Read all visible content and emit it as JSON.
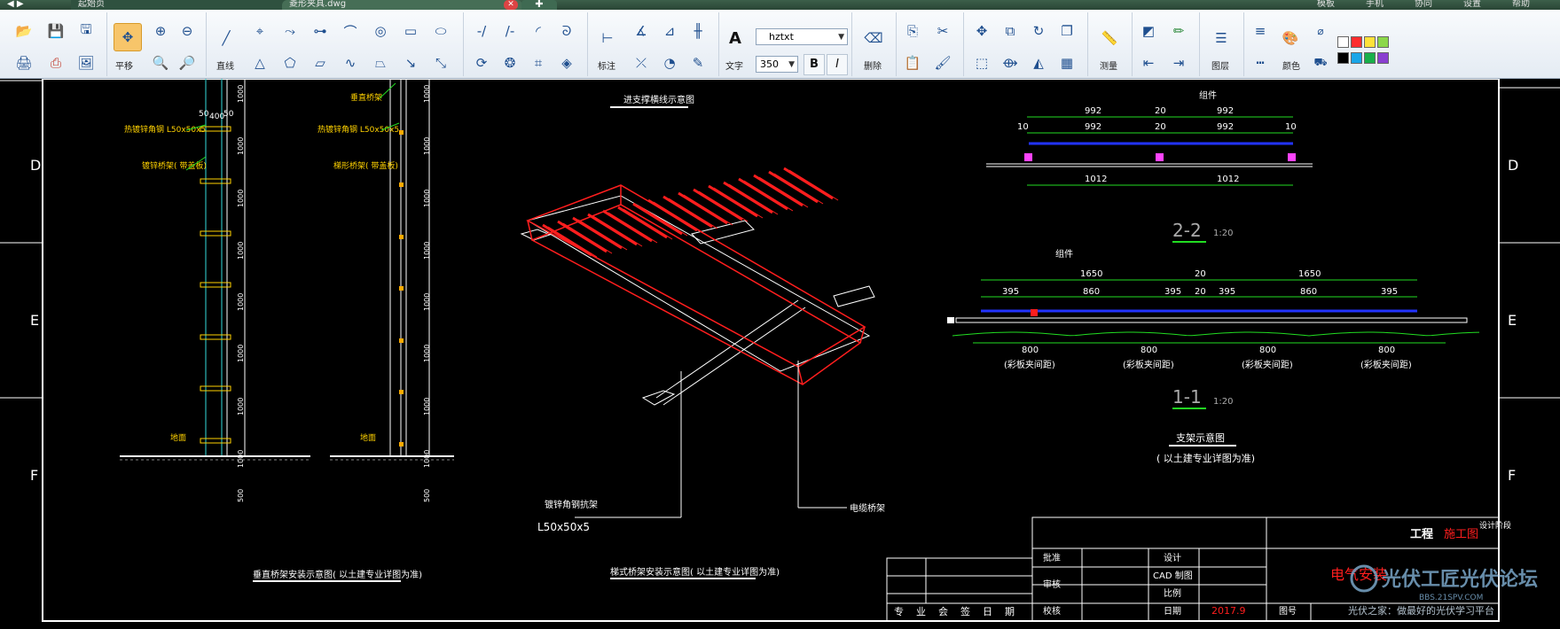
{
  "tabs": {
    "home": "起始页",
    "active": "菱形夹具.dwg",
    "close_glyph": "✕",
    "new_glyph": "✚"
  },
  "top_menu": [
    "模板",
    "手机",
    "协同",
    "设置",
    "帮助"
  ],
  "toolbar": {
    "pan_label": "平移",
    "line_label": "直线",
    "annotate_label": "标注",
    "text_label": "文字",
    "font_name": "hztxt",
    "font_size": "350",
    "bold": "B",
    "italic": "I",
    "delete_label": "删除",
    "measure_label": "测量",
    "layer_label": "图层",
    "color_label": "颜色"
  },
  "colors": {
    "swatches_row1": [
      "#ffffff",
      "#ff2d2d",
      "#ffe23a",
      "#8bd74a"
    ],
    "swatches_row2": [
      "#000000",
      "#1aa6e8",
      "#19b04a",
      "#8a3fd0"
    ],
    "cad_red": "#ff1e1e",
    "cad_green": "#22dd22",
    "cad_cyan": "#33dddd",
    "cad_white": "#ffffff",
    "cad_yellow": "#ffd200",
    "cad_magenta": "#ff44ff"
  },
  "drawing": {
    "row_labels": [
      "D",
      "E",
      "F"
    ],
    "vertical_title": "垂直桥架安装示意图( 以土建专业详图为准)",
    "ladder_label": "进支撑横线示意图",
    "tray_title": "梯式桥架安装示意图( 以土建专业详图为准)",
    "bracket_label": "镀锌角钢抗架",
    "bracket_size": "L50x50x5",
    "tray_label": "电缆桥架",
    "left_annotations": [
      "热镀锌角钢 L50x50x5",
      "镀锌桥架( 带盖板)",
      "地面"
    ],
    "right_annotations": [
      "垂直桥架",
      "热镀锌角钢 L50x50x5",
      "梯形桥架( 带盖板)",
      "地面"
    ],
    "dim_top": [
      "50",
      "400",
      "50"
    ],
    "vertical_dims": [
      "1000",
      "1000",
      "1000",
      "1000",
      "1000",
      "1000",
      "1000",
      "1000",
      "500"
    ],
    "section22": {
      "part": "组件",
      "top_dims": [
        "992",
        "20",
        "992"
      ],
      "second_dims": [
        "10",
        "992",
        "20",
        "992",
        "10"
      ],
      "bottom_dims": [
        "1012",
        "1012"
      ],
      "title": "2-2",
      "scale": "1:20"
    },
    "section11": {
      "part": "组件",
      "top_dims": [
        "1650",
        "20",
        "1650"
      ],
      "second_dims": [
        "395",
        "860",
        "395",
        "20",
        "395",
        "860",
        "395"
      ],
      "bottom_dims": [
        "800",
        "800",
        "800",
        "800"
      ],
      "bottom_notes": [
        "(彩板夹间距)",
        "(彩板夹间距)",
        "(彩板夹间距)",
        "(彩板夹间距)"
      ],
      "title": "1-1",
      "scale": "1:20"
    },
    "support_title": "支架示意图",
    "support_note": "( 以土建专业详图为准)"
  },
  "title_block": {
    "project": "工程",
    "stage": "施工图",
    "design_stage": "设计阶段",
    "approve": "批准",
    "review": "审核",
    "check": "校核",
    "design": "设计",
    "cad": "CAD 制图",
    "scale": "比例",
    "date": "日期",
    "date_value": "2017.9",
    "drawing_no": "图号",
    "sign_row": "专业会签日期",
    "red_title": "电气安装"
  },
  "watermark": {
    "line1": "光伏工匠光伏论坛",
    "line2": "BBS.21SPV.COM",
    "line3": "光伏之家：做最好的光伏学习平台"
  }
}
